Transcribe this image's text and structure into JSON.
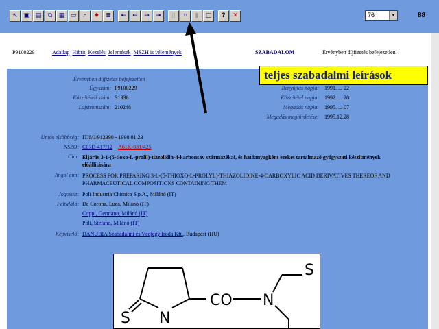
{
  "toolbar": {
    "buttons": [
      {
        "name": "select-icon",
        "glyph": "↖"
      },
      {
        "name": "save-icon",
        "glyph": "▣"
      },
      {
        "name": "print-setup-icon",
        "glyph": "▤"
      },
      {
        "name": "copy-icon",
        "glyph": "⧉"
      },
      {
        "name": "print-icon",
        "glyph": "▦"
      },
      {
        "name": "open-icon",
        "glyph": "▭"
      },
      {
        "name": "find-icon",
        "glyph": "⌕"
      },
      {
        "name": "bookmark-icon",
        "glyph": "♦"
      },
      {
        "name": "list-icon",
        "glyph": "≣"
      },
      {
        "name": "first-page-icon",
        "glyph": "⇤"
      },
      {
        "name": "prev-page-icon",
        "glyph": "←"
      },
      {
        "name": "next-page-icon",
        "glyph": "→"
      },
      {
        "name": "last-page-icon",
        "glyph": "⇥"
      },
      {
        "name": "page-icon",
        "glyph": "▯"
      },
      {
        "name": "full-description-icon",
        "glyph": "⌗"
      },
      {
        "name": "document-icon",
        "glyph": "▮"
      },
      {
        "name": "window-icon",
        "glyph": "□"
      },
      {
        "name": "help-icon",
        "glyph": "?"
      },
      {
        "name": "close-icon",
        "glyph": "✕"
      }
    ],
    "zoom_value": "76",
    "page_number": "88"
  },
  "header": {
    "doc_id": "P9100229",
    "links": [
      "Adatlap",
      "Hibrit",
      "Kezelés",
      "Jelentések",
      "MSZH is vélemények"
    ],
    "section_title": "SZABADALOM",
    "description": "Érvényben díjfizetés befejezetlen."
  },
  "callout": {
    "text": "teljes szabadalmi leírások"
  },
  "record": {
    "status_title": "Érvényben díjfizetés befejezetlen",
    "left": [
      {
        "label": "Ügyszám:",
        "value": "P9100229"
      },
      {
        "label": "Közzétételi szám:",
        "value": "S1336"
      },
      {
        "label": "Lajstromszám:",
        "value": "210248"
      }
    ],
    "right": [
      {
        "label": "Benyújtás napja:",
        "value": "1991. ... 22"
      },
      {
        "label": "Közzététel napja:",
        "value": "1992. ... 28"
      },
      {
        "label": "Megadás napja:",
        "value": "1995. ... 07"
      },
      {
        "label": "Megadás meghirdetése:",
        "value": "1995.12.28"
      }
    ],
    "priority_label": "Uniós elsőbbség:",
    "priority_value": "IT/MI/912390 - 1990.01.23",
    "nszo_label": "NSZO:",
    "nszo_link1": "C07D-417/12",
    "nszo_link2": "A61K-031/425",
    "title_label": "Cím:",
    "title_hu": "Eljárás 3-1-(5-tioxo-L-prolil)-tiazolidin-4-karbonsav származékai, és hatóanyagként ezeket tartalmazó gyógyszati készítmények előállítására",
    "title_en_label": "Angol cím:",
    "title_en": "PROCESS FOR PREPARING 3-L-(5-THIOXO-L-PROLYL)-THIAZOLIDINE-4-CARBOXYLIC ACID DERIVATIVES THEREOF AND PHARMACEUTICAL COMPOSITIONS CONTAINING THEM",
    "owner_label": "Jogosult:",
    "owner_value": "Poli Industria Chimica S.p.A., Milánó (IT)",
    "inventor_label": "Feltaláló:",
    "inventors": [
      "De Corona, Luca, Milánó (IT)",
      "Coppi, Germano, Milánó (IT)",
      "Poli, Stefano, Milánó (IT)"
    ],
    "rep_label": "Képviselő:",
    "rep_link": "DANUBIA Szabadalmi és Védjegy Iroda Kft.",
    "rep_value": ", Budapest (HU)"
  },
  "structure": {
    "atoms": [
      "S",
      "N",
      "CO",
      "N",
      "S"
    ]
  }
}
